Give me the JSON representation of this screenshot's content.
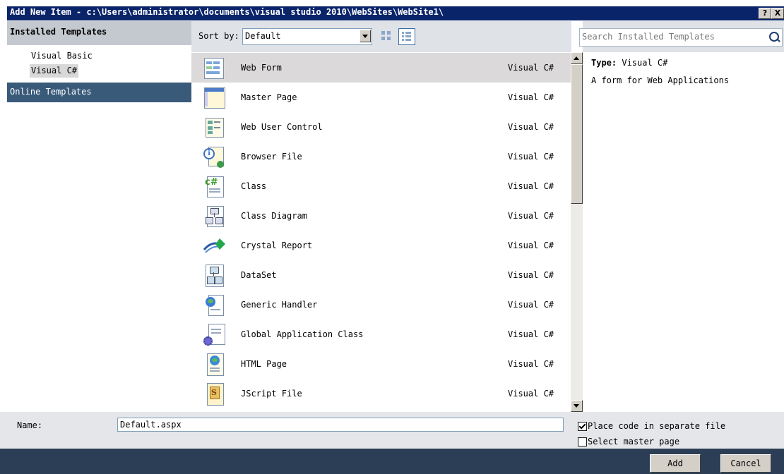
{
  "window": {
    "title": "Add New Item - c:\\Users\\administrator\\documents\\visual studio 2010\\WebSites\\WebSite1\\",
    "help_label": "?",
    "close_label": "X"
  },
  "left": {
    "installed_header": "Installed Templates",
    "languages": [
      "Visual Basic",
      "Visual C#"
    ],
    "online_header": "Online Templates"
  },
  "toolbar": {
    "sort_label": "Sort by:",
    "sort_value": "Default"
  },
  "search": {
    "placeholder": "Search Installed Templates"
  },
  "items": [
    {
      "name": "Web Form",
      "lang": "Visual C#",
      "icon": "web-form-icon"
    },
    {
      "name": "Master Page",
      "lang": "Visual C#",
      "icon": "master-page-icon"
    },
    {
      "name": "Web User Control",
      "lang": "Visual C#",
      "icon": "web-user-control-icon"
    },
    {
      "name": "Browser File",
      "lang": "Visual C#",
      "icon": "browser-file-icon"
    },
    {
      "name": "Class",
      "lang": "Visual C#",
      "icon": "class-icon"
    },
    {
      "name": "Class Diagram",
      "lang": "Visual C#",
      "icon": "class-diagram-icon"
    },
    {
      "name": "Crystal Report",
      "lang": "Visual C#",
      "icon": "crystal-report-icon"
    },
    {
      "name": "DataSet",
      "lang": "Visual C#",
      "icon": "dataset-icon"
    },
    {
      "name": "Generic Handler",
      "lang": "Visual C#",
      "icon": "generic-handler-icon"
    },
    {
      "name": "Global Application Class",
      "lang": "Visual C#",
      "icon": "global-application-class-icon"
    },
    {
      "name": "HTML Page",
      "lang": "Visual C#",
      "icon": "html-page-icon"
    },
    {
      "name": "JScript File",
      "lang": "Visual C#",
      "icon": "jscript-file-icon"
    }
  ],
  "details": {
    "type_label": "Type:",
    "type_value": "Visual C#",
    "description": "A form for Web Applications"
  },
  "bottom": {
    "name_label": "Name:",
    "name_value": "Default.aspx",
    "separate_file_label": "Place code in separate file",
    "separate_file_checked": true,
    "master_page_label": "Select master page",
    "master_page_checked": false,
    "add_label": "Add",
    "cancel_label": "Cancel"
  },
  "colors": {
    "title_bar": "#0a246a",
    "online_header": "#3a5a7a",
    "footer": "#2c3e55",
    "selected_row": "#dbd9d9"
  }
}
